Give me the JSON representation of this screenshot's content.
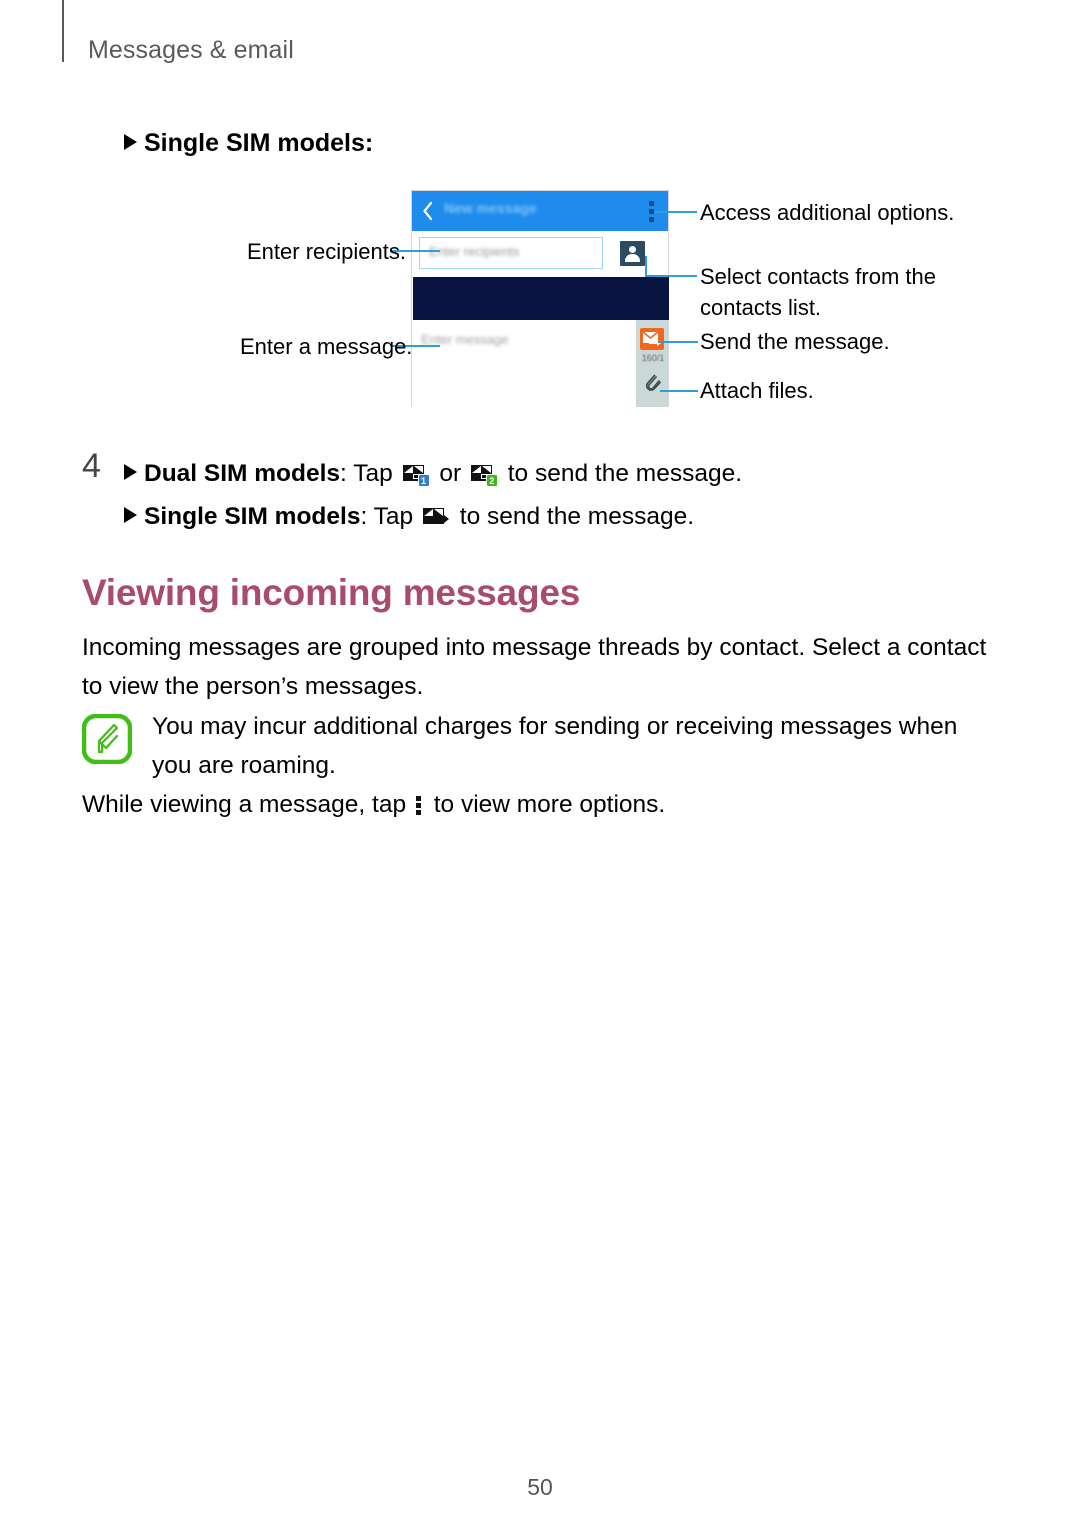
{
  "header": {
    "chapter": "Messages & email"
  },
  "subhead": {
    "label": "Single SIM models:"
  },
  "phone_mock": {
    "appbar_title": "New message",
    "back_icon": "chevron-left-icon",
    "more_icon": "overflow-menu-icon",
    "recipient_placeholder": "Enter recipients",
    "contacts_icon": "contacts-person-icon",
    "message_placeholder": "Enter message",
    "send_icon": "send-message-icon",
    "char_count": "160/1",
    "attach_icon": "paperclip-icon",
    "colors": {
      "appbar": "#1f8ced",
      "darkband": "#0a1440",
      "send_button": "#f2661e",
      "rail": "#ccd7d7",
      "leader": "#2f9fd8"
    }
  },
  "callouts": [
    {
      "id": "access-options",
      "text": "Access additional options."
    },
    {
      "id": "select-contacts",
      "line1": "Select contacts from the",
      "line2": "contacts list."
    },
    {
      "id": "send-message",
      "text": "Send the message."
    },
    {
      "id": "attach-files",
      "text": "Attach files."
    },
    {
      "id": "enter-recipients",
      "text": "Enter recipients."
    },
    {
      "id": "enter-message",
      "text": "Enter a message."
    }
  ],
  "step4": {
    "number": "4",
    "dual_label": "Dual SIM models",
    "dual_pre": ": Tap ",
    "dual_mid": " or ",
    "dual_post": " to send the message.",
    "single_label": "Single SIM models",
    "single_pre": ": Tap ",
    "single_post": " to send the message.",
    "sim1": "1",
    "sim2": "2",
    "sim1_color": "#2e7fd4",
    "sim2_color": "#3fb81e"
  },
  "section": {
    "heading": "Viewing incoming messages",
    "heading_color": "#a94c6c",
    "intro": "Incoming messages are grouped into message threads by contact. Select a contact to view the person’s messages."
  },
  "note": {
    "icon": "samsung-note-icon",
    "icon_color": "#3fbf16",
    "text": "You may incur additional charges for sending or receiving messages when you are roaming."
  },
  "tail": {
    "pre": "While viewing a message, tap ",
    "post": " to view more options."
  },
  "footer": {
    "page_number": "50"
  }
}
